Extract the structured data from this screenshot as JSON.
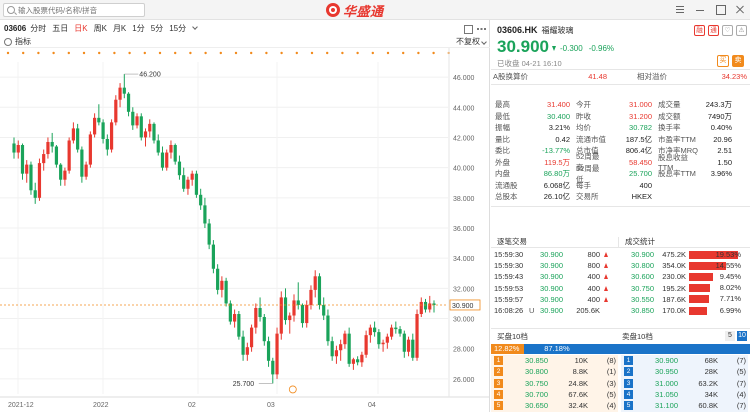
{
  "topbar": {
    "search_placeholder": "输入股票代码/名称/拼音",
    "logo_text": "华盛通"
  },
  "chart_tabs": {
    "code": "03606",
    "tabs": [
      "分时",
      "五日",
      "日K",
      "周K",
      "月K",
      "1分",
      "5分",
      "15分"
    ],
    "active": "日K",
    "indicator_label": "指标",
    "adjust_label": "不复权"
  },
  "chart_data": {
    "type": "candlestick",
    "y_ticks": [
      "46.000",
      "44.000",
      "42.000",
      "40.000",
      "38.000",
      "36.000",
      "34.000",
      "32.000",
      "30.000",
      "28.000",
      "26.000"
    ],
    "ylim": [
      25.0,
      47.0
    ],
    "x_ticks": [
      "2021-12",
      "2022",
      "02",
      "03",
      "04"
    ],
    "current_price_label": "30.900",
    "high_marker": "46.200",
    "low_marker": "25.700",
    "colors": {
      "up": "#e8382f",
      "down": "#1aa35a",
      "current_line": "#f18a1c"
    },
    "candles": [
      [
        41.6,
        42.0,
        40.6,
        41.0
      ],
      [
        41.0,
        41.8,
        40.6,
        41.5
      ],
      [
        41.5,
        41.6,
        39.2,
        39.6
      ],
      [
        39.6,
        40.5,
        39.0,
        40.2
      ],
      [
        40.2,
        40.4,
        38.2,
        38.5
      ],
      [
        38.5,
        39.0,
        37.6,
        38.0
      ],
      [
        38.0,
        40.6,
        37.8,
        40.3
      ],
      [
        40.3,
        41.2,
        39.8,
        40.9
      ],
      [
        40.9,
        42.0,
        40.6,
        41.7
      ],
      [
        41.7,
        42.3,
        41.0,
        41.4
      ],
      [
        41.4,
        41.5,
        40.0,
        40.2
      ],
      [
        40.2,
        40.3,
        38.8,
        39.2
      ],
      [
        39.2,
        40.0,
        38.8,
        39.8
      ],
      [
        39.8,
        42.0,
        39.6,
        41.8
      ],
      [
        41.8,
        43.0,
        41.6,
        42.6
      ],
      [
        42.6,
        42.9,
        41.0,
        41.2
      ],
      [
        41.2,
        41.4,
        39.0,
        39.4
      ],
      [
        39.4,
        40.4,
        39.2,
        40.2
      ],
      [
        40.2,
        42.4,
        40.0,
        42.2
      ],
      [
        42.2,
        43.6,
        42.0,
        43.3
      ],
      [
        43.3,
        44.2,
        42.8,
        43.0
      ],
      [
        43.0,
        43.2,
        41.6,
        41.9
      ],
      [
        41.9,
        42.2,
        40.8,
        41.2
      ],
      [
        41.2,
        43.2,
        41.0,
        43.0
      ],
      [
        43.0,
        44.8,
        42.8,
        44.5
      ],
      [
        44.5,
        45.6,
        44.0,
        45.3
      ],
      [
        45.3,
        46.2,
        44.6,
        44.9
      ],
      [
        44.9,
        45.0,
        43.4,
        43.7
      ],
      [
        43.7,
        44.0,
        42.5,
        42.8
      ],
      [
        42.8,
        43.6,
        42.6,
        43.4
      ],
      [
        43.4,
        43.6,
        41.8,
        42.0
      ],
      [
        42.0,
        42.6,
        41.4,
        42.4
      ],
      [
        42.4,
        43.2,
        42.0,
        42.9
      ],
      [
        42.9,
        43.0,
        41.6,
        41.8
      ],
      [
        41.8,
        42.2,
        40.8,
        41.0
      ],
      [
        41.0,
        41.4,
        39.8,
        40.0
      ],
      [
        40.0,
        41.2,
        39.8,
        41.0
      ],
      [
        41.0,
        41.8,
        40.6,
        41.5
      ],
      [
        41.5,
        41.6,
        40.2,
        40.4
      ],
      [
        40.4,
        40.8,
        39.2,
        39.5
      ],
      [
        39.5,
        40.0,
        38.4,
        38.6
      ],
      [
        38.6,
        39.4,
        38.2,
        39.2
      ],
      [
        39.2,
        39.8,
        38.8,
        39.6
      ],
      [
        39.6,
        39.8,
        38.0,
        38.2
      ],
      [
        38.2,
        38.6,
        37.2,
        37.5
      ],
      [
        37.5,
        38.0,
        36.0,
        36.3
      ],
      [
        36.3,
        36.6,
        34.6,
        34.9
      ],
      [
        34.9,
        35.2,
        33.0,
        33.3
      ],
      [
        33.3,
        33.6,
        31.6,
        31.9
      ],
      [
        31.9,
        32.8,
        31.4,
        32.5
      ],
      [
        32.5,
        32.7,
        30.8,
        31.0
      ],
      [
        31.0,
        31.2,
        29.6,
        29.8
      ],
      [
        29.8,
        30.6,
        29.4,
        30.3
      ],
      [
        30.3,
        30.5,
        28.6,
        28.8
      ],
      [
        28.8,
        29.2,
        27.2,
        27.6
      ],
      [
        27.6,
        28.4,
        27.2,
        28.1
      ],
      [
        28.1,
        29.6,
        27.8,
        29.4
      ],
      [
        29.4,
        31.0,
        29.0,
        30.7
      ],
      [
        30.7,
        31.4,
        29.8,
        30.1
      ],
      [
        30.1,
        30.3,
        28.2,
        28.5
      ],
      [
        28.5,
        28.8,
        26.8,
        27.2
      ],
      [
        27.2,
        27.4,
        25.7,
        26.3
      ],
      [
        26.3,
        29.4,
        26.0,
        29.0
      ],
      [
        29.0,
        31.8,
        28.6,
        31.4
      ],
      [
        31.4,
        32.0,
        29.6,
        29.9
      ],
      [
        29.9,
        30.4,
        29.0,
        30.2
      ],
      [
        30.2,
        31.6,
        29.8,
        31.2
      ],
      [
        31.2,
        32.4,
        30.6,
        30.9
      ],
      [
        30.9,
        31.0,
        29.4,
        29.7
      ],
      [
        29.7,
        31.2,
        29.4,
        30.9
      ],
      [
        30.9,
        32.2,
        30.6,
        31.9
      ],
      [
        31.9,
        33.2,
        31.4,
        32.8
      ],
      [
        32.8,
        33.0,
        30.6,
        30.9
      ],
      [
        30.9,
        31.4,
        29.9,
        30.2
      ],
      [
        30.2,
        30.6,
        28.2,
        28.5
      ],
      [
        28.5,
        28.8,
        27.2,
        27.5
      ],
      [
        27.5,
        28.2,
        27.0,
        27.9
      ],
      [
        27.9,
        28.6,
        27.2,
        28.3
      ],
      [
        28.3,
        29.2,
        28.0,
        29.0
      ],
      [
        29.0,
        29.4,
        26.8,
        27.0
      ],
      [
        27.0,
        27.4,
        26.6,
        27.3
      ],
      [
        27.3,
        27.5,
        26.9,
        27.1
      ],
      [
        27.1,
        27.8,
        26.8,
        27.6
      ],
      [
        27.6,
        29.2,
        27.4,
        28.9
      ],
      [
        28.9,
        29.6,
        28.4,
        29.4
      ],
      [
        29.4,
        29.8,
        28.8,
        29.1
      ],
      [
        29.1,
        29.3,
        28.0,
        28.3
      ],
      [
        28.3,
        28.6,
        27.8,
        28.4
      ],
      [
        28.4,
        29.0,
        28.0,
        28.8
      ],
      [
        28.8,
        29.6,
        28.6,
        29.4
      ],
      [
        29.4,
        29.8,
        29.0,
        29.3
      ],
      [
        29.3,
        29.5,
        28.8,
        29.0
      ],
      [
        29.0,
        29.2,
        27.4,
        27.8
      ],
      [
        27.8,
        28.8,
        27.5,
        28.6
      ],
      [
        28.6,
        29.0,
        27.2,
        27.4
      ],
      [
        27.4,
        30.6,
        27.2,
        30.3
      ],
      [
        30.3,
        31.4,
        30.1,
        31.1
      ],
      [
        31.1,
        31.3,
        30.4,
        30.6
      ],
      [
        30.6,
        31.5,
        30.4,
        31.0
      ],
      [
        31.0,
        31.2,
        30.4,
        30.9
      ]
    ]
  },
  "quote": {
    "title": "03606.HK",
    "name": "福耀玻璃",
    "badges": [
      "融",
      "通",
      "♡",
      "⚠"
    ],
    "price": "30.900",
    "change": "-0.300",
    "change_pct": "-0.96%",
    "status": "已收盘 04-21 16:10",
    "btn_buy": "买",
    "btn_sell": "卖",
    "a_label": "A股换算价",
    "a_value": "41.48",
    "prem_label": "相对溢价",
    "prem_value": "34.23%"
  },
  "stats": [
    [
      "最高",
      "31.400",
      "今开",
      "31.000",
      "成交量",
      "243.3万"
    ],
    [
      "最低",
      "30.400",
      "昨收",
      "31.200",
      "成交额",
      "7490万"
    ],
    [
      "振幅",
      "3.21%",
      "均价",
      "30.782",
      "换手率",
      "0.40%"
    ],
    [
      "量比",
      "0.42",
      "流通市值",
      "187.5亿",
      "市盈率TTM",
      "20.96"
    ],
    [
      "委比",
      "-13.77%",
      "总市值",
      "806.4亿",
      "市净率MRQ",
      "2.51"
    ],
    [
      "外盘",
      "119.5万",
      "52周最高",
      "58.450",
      "股息收益TTM",
      "1.50"
    ],
    [
      "内盘",
      "86.80万",
      "52周最低",
      "25.700",
      "股息率TTM",
      "3.96%"
    ],
    [
      "流通股",
      "6.068亿",
      "每手",
      "400",
      "",
      ""
    ],
    [
      "总股本",
      "26.10亿",
      "交易所",
      "HKEX",
      "",
      ""
    ]
  ],
  "trades_header": "逐笔交易",
  "dist_header": "成交统计",
  "ticks": [
    {
      "t": "15:59:30",
      "d": "",
      "p": "30.900",
      "q": "800",
      "dir": "up"
    },
    {
      "t": "15:59:30",
      "d": "",
      "p": "30.900",
      "q": "800",
      "dir": "up"
    },
    {
      "t": "15:59:43",
      "d": "",
      "p": "30.900",
      "q": "400",
      "dir": "up"
    },
    {
      "t": "15:59:53",
      "d": "",
      "p": "30.900",
      "q": "400",
      "dir": "up"
    },
    {
      "t": "15:59:57",
      "d": "",
      "p": "30.900",
      "q": "400",
      "dir": "up"
    },
    {
      "t": "16:08:26",
      "d": "U",
      "p": "30.900",
      "q": "205.6K",
      "dir": ""
    }
  ],
  "dist": [
    {
      "p": "30.900",
      "v": "475.2K",
      "pct": "19.53%",
      "frac": 0.95
    },
    {
      "p": "30.800",
      "v": "354.0K",
      "pct": "14.55%",
      "frac": 0.72
    },
    {
      "p": "30.600",
      "v": "230.0K",
      "pct": "9.45%",
      "frac": 0.47
    },
    {
      "p": "30.750",
      "v": "195.2K",
      "pct": "8.02%",
      "frac": 0.4
    },
    {
      "p": "30.550",
      "v": "187.6K",
      "pct": "7.71%",
      "frac": 0.38
    },
    {
      "p": "30.850",
      "v": "170.0K",
      "pct": "6.99%",
      "frac": 0.34
    }
  ],
  "book": {
    "bid_header": "买盘10档",
    "ask_header": "卖盘10档",
    "level5": "5",
    "level10": "10",
    "buy_ratio": "12.82%",
    "sell_ratio": "87.18%",
    "buy_fraction": 0.1282,
    "bids": [
      {
        "n": "1",
        "p": "30.850",
        "v": "10K",
        "c": "(8)"
      },
      {
        "n": "2",
        "p": "30.800",
        "v": "8.8K",
        "c": "(1)"
      },
      {
        "n": "3",
        "p": "30.750",
        "v": "24.8K",
        "c": "(3)"
      },
      {
        "n": "4",
        "p": "30.700",
        "v": "67.6K",
        "c": "(5)"
      },
      {
        "n": "5",
        "p": "30.650",
        "v": "32.4K",
        "c": "(4)"
      },
      {
        "n": "6",
        "p": "30.600",
        "v": "46.4K",
        "c": "(4)"
      }
    ],
    "asks": [
      {
        "n": "1",
        "p": "30.900",
        "v": "68K",
        "c": "(7)"
      },
      {
        "n": "2",
        "p": "30.950",
        "v": "28K",
        "c": "(5)"
      },
      {
        "n": "3",
        "p": "31.000",
        "v": "63.2K",
        "c": "(7)"
      },
      {
        "n": "4",
        "p": "31.050",
        "v": "34K",
        "c": "(4)"
      },
      {
        "n": "5",
        "p": "31.100",
        "v": "60.8K",
        "c": "(7)"
      },
      {
        "n": "6",
        "p": "31.150",
        "v": "42K",
        "c": "(4)"
      }
    ]
  }
}
